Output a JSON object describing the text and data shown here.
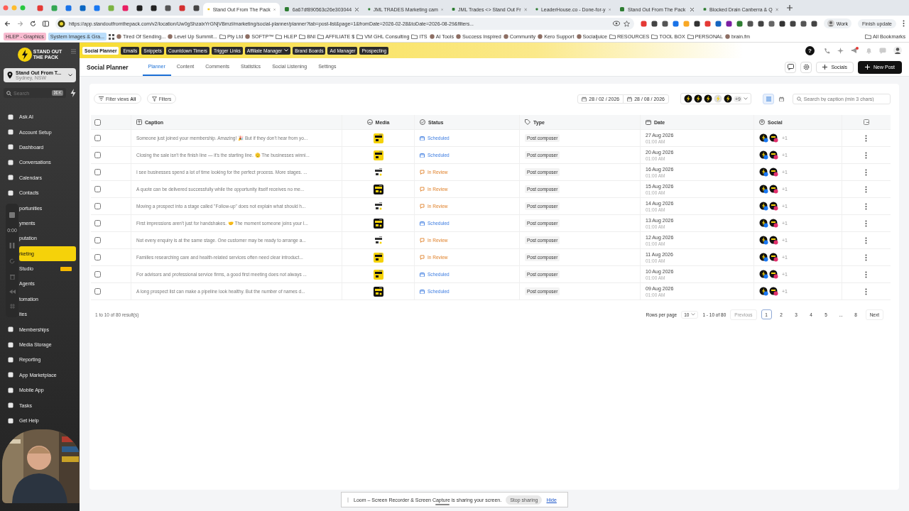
{
  "browser": {
    "pinned_tabs": [
      {
        "color": "#e53935"
      },
      {
        "color": "#34a853"
      },
      {
        "color": "#1a73e8"
      },
      {
        "color": "#0a66c2"
      },
      {
        "color": "#1877f2"
      },
      {
        "color": "#7cb342"
      },
      {
        "color": "#e91e63"
      },
      {
        "color": "#222222"
      },
      {
        "color": "#222222"
      },
      {
        "color": "#555555"
      },
      {
        "color": "#d32f2f"
      },
      {
        "color": "#444444"
      }
    ],
    "tabs": [
      {
        "title": "Stand Out From The Pack",
        "selected": true
      },
      {
        "title": "6a67df890563c26e303044",
        "selected": false
      },
      {
        "title": "JML TRADES Marketing cam",
        "selected": false
      },
      {
        "title": "JML Trades <> Stand Out Fr",
        "selected": false
      },
      {
        "title": "LeaderHouse.co - Done-for-y",
        "selected": false
      },
      {
        "title": "Stand Out From The Pack",
        "selected": false
      },
      {
        "title": "Blocked Drain Canberra & Q",
        "selected": false
      }
    ],
    "url": "https://app.standoutfromthepack.com/v2/location/Uw0gShzaixYrGNjVBmzl/marketing/social-planner/planner?tab=post-list&page=1&fromDate=2026-02-28&toDate=2026-08-29&filters...",
    "profile": "Work",
    "update_button": "Finish update",
    "bookmarks": [
      {
        "label": "HLEP - Graphics",
        "kind": "tag",
        "color": "#f8bbd0"
      },
      {
        "label": "System Images & Gra...",
        "kind": "tag",
        "color": "#bbdefb"
      },
      {
        "label": "Tired Of Sending...",
        "kind": "link"
      },
      {
        "label": "Level Up Summit...",
        "kind": "link"
      },
      {
        "label": "Pty Ltd",
        "kind": "folder"
      },
      {
        "label": "SOFTP™",
        "kind": "link"
      },
      {
        "label": "HLEP",
        "kind": "folder"
      },
      {
        "label": "BNI",
        "kind": "folder"
      },
      {
        "label": "AFFILIATE $",
        "kind": "folder"
      },
      {
        "label": "VM GHL Consulting",
        "kind": "folder"
      },
      {
        "label": "ITS",
        "kind": "folder"
      },
      {
        "label": "AI Tools",
        "kind": "link"
      },
      {
        "label": "Success Inspired",
        "kind": "link"
      },
      {
        "label": "Community",
        "kind": "link"
      },
      {
        "label": "Kero Support",
        "kind": "link"
      },
      {
        "label": "Socialjuice",
        "kind": "link"
      },
      {
        "label": "RESOURCES",
        "kind": "folder"
      },
      {
        "label": "TOOL BOX",
        "kind": "folder"
      },
      {
        "label": "PERSONAL",
        "kind": "folder"
      },
      {
        "label": "brain.fm",
        "kind": "link"
      }
    ],
    "all_bookmarks": "All Bookmarks"
  },
  "sidebar": {
    "logo": [
      "STAND OUT",
      "THE PACK"
    ],
    "location": {
      "name": "Stand Out From T...",
      "place": "Sydney, NSW"
    },
    "search": {
      "placeholder": "Search",
      "shortcut": "⌘K"
    },
    "items": [
      {
        "label": "Ask AI",
        "selected": false,
        "covered": false
      },
      {
        "label": "Account Setup",
        "selected": false,
        "covered": false
      },
      {
        "label": "Dashboard",
        "selected": false,
        "covered": false
      },
      {
        "label": "Conversations",
        "selected": false,
        "covered": false
      },
      {
        "label": "Calendars",
        "selected": false,
        "covered": false
      },
      {
        "label": "Contacts",
        "selected": false,
        "covered": false
      },
      {
        "label": "portunities",
        "selected": false,
        "covered": true
      },
      {
        "label": "yments",
        "selected": false,
        "covered": true
      },
      {
        "label": "putation",
        "selected": false,
        "covered": true
      },
      {
        "label": "rketing",
        "selected": true,
        "covered": true
      },
      {
        "label": "Studio",
        "selected": false,
        "covered": true,
        "badge": true
      },
      {
        "label": "Agents",
        "selected": false,
        "covered": true
      },
      {
        "label": "tomation",
        "selected": false,
        "covered": true
      },
      {
        "label": "ites",
        "selected": false,
        "covered": true
      },
      {
        "label": "Memberships",
        "selected": false,
        "covered": false
      },
      {
        "label": "Media Storage",
        "selected": false,
        "covered": false
      },
      {
        "label": "Reporting",
        "selected": false,
        "covered": false
      },
      {
        "label": "App Marketplace",
        "selected": false,
        "covered": false
      },
      {
        "label": "Mobile App",
        "selected": false,
        "covered": false
      },
      {
        "label": "Tasks",
        "selected": false,
        "covered": false
      },
      {
        "label": "Get Help",
        "selected": false,
        "covered": false
      }
    ],
    "recorder": {
      "time": "0:00"
    }
  },
  "topbar": {
    "items": [
      {
        "label": "Social Planner",
        "selected": true
      },
      {
        "label": "Emails",
        "selected": false
      },
      {
        "label": "Snippets",
        "selected": false
      },
      {
        "label": "Countdown Timers",
        "selected": false
      },
      {
        "label": "Trigger Links",
        "selected": false
      },
      {
        "label": "Affiliate Manager",
        "selected": false,
        "dropdown": true
      },
      {
        "label": "Brand Boards",
        "selected": false
      },
      {
        "label": "Ad Manager",
        "selected": false
      },
      {
        "label": "Prospecting",
        "selected": false
      }
    ],
    "help": "?"
  },
  "header": {
    "title": "Social Planner",
    "tabs": [
      {
        "label": "Planner",
        "selected": true
      },
      {
        "label": "Content",
        "selected": false
      },
      {
        "label": "Comments",
        "selected": false
      },
      {
        "label": "Statistics",
        "selected": false
      },
      {
        "label": "Social Listening",
        "selected": false
      },
      {
        "label": "Settings",
        "selected": false
      }
    ],
    "socials_button": "Socials",
    "new_post_button": "New Post"
  },
  "filters": {
    "filter_views": "Filter views **All**",
    "filters_button": "Filters",
    "date_from": "28 / 02 / 2026",
    "date_to": "28 / 08 / 2026",
    "more_accounts": "+9",
    "views": [
      {
        "kind": "list",
        "selected": true
      },
      {
        "kind": "calendar",
        "selected": false
      }
    ],
    "search": {
      "placeholder": "Search by caption (min 3 chars)"
    }
  },
  "table": {
    "all_checked": false,
    "columns": [
      "Caption",
      "Media",
      "Status",
      "Type",
      "Date",
      "Social"
    ],
    "rows": [
      {
        "checked": false,
        "caption": "Someone just joined your membership. Amazing! 🎉 But if they don't hear from yo...",
        "status": {
          "label": "Scheduled",
          "kind": "scheduled"
        },
        "type": "Post composer",
        "date": "27 Aug 2026",
        "time": "01:00 AM",
        "social_more": "+1"
      },
      {
        "checked": false,
        "caption": "Closing the sale isn't the finish line — it's the starting line. 🫡 The businesses winni...",
        "status": {
          "label": "Scheduled",
          "kind": "scheduled"
        },
        "type": "Post composer",
        "date": "20 Aug 2026",
        "time": "01:00 AM",
        "social_more": "+1"
      },
      {
        "checked": false,
        "caption": "I see businesses spend a lot of time looking for the perfect process. More stages. ...",
        "status": {
          "label": "In Review",
          "kind": "review"
        },
        "type": "Post composer",
        "date": "16 Aug 2026",
        "time": "01:00 AM",
        "social_more": "+1"
      },
      {
        "checked": false,
        "caption": "A quote can be delivered successfully while the opportunity itself receives no me...",
        "status": {
          "label": "In Review",
          "kind": "review"
        },
        "type": "Post composer",
        "date": "15 Aug 2026",
        "time": "01:00 AM",
        "social_more": "+1"
      },
      {
        "checked": false,
        "caption": "Moving a prospect into a stage called \"Follow-up\" does not explain what should h...",
        "status": {
          "label": "In Review",
          "kind": "review"
        },
        "type": "Post composer",
        "date": "14 Aug 2026",
        "time": "01:00 AM",
        "social_more": "+1"
      },
      {
        "checked": false,
        "caption": "First impressions aren't just for handshakes. 🤝 The moment someone joins your l...",
        "status": {
          "label": "Scheduled",
          "kind": "scheduled"
        },
        "type": "Post composer",
        "date": "13 Aug 2026",
        "time": "01:00 AM",
        "social_more": "+1"
      },
      {
        "checked": false,
        "caption": "Not every enquiry is at the same stage. One customer may be ready to arrange a...",
        "status": {
          "label": "In Review",
          "kind": "review"
        },
        "type": "Post composer",
        "date": "12 Aug 2026",
        "time": "01:00 AM",
        "social_more": "+1"
      },
      {
        "checked": false,
        "caption": "Families researching care and health-related services often need clear introduct...",
        "status": {
          "label": "In Review",
          "kind": "review"
        },
        "type": "Post composer",
        "date": "11 Aug 2026",
        "time": "01:00 AM",
        "social_more": "+1"
      },
      {
        "checked": false,
        "caption": "For advisors and professional service firms, a good first meeting does not always ...",
        "status": {
          "label": "Scheduled",
          "kind": "scheduled"
        },
        "type": "Post composer",
        "date": "10 Aug 2026",
        "time": "01:00 AM",
        "social_more": "+1"
      },
      {
        "checked": false,
        "caption": "A long prospect list can make a pipeline look healthy. But the number of names d...",
        "status": {
          "label": "Scheduled",
          "kind": "scheduled"
        },
        "type": "Post composer",
        "date": "09 Aug 2026",
        "time": "01:00 AM",
        "social_more": "+1"
      }
    ]
  },
  "footer": {
    "results": "1 to 10 of 80 result(s)",
    "rows_per_page_label": "Rows per page",
    "rows_per_page": "10",
    "range": "1 - 10 of 80",
    "previous": {
      "label": "Previous",
      "disabled": true
    },
    "pages": [
      {
        "label": "1",
        "selected": true
      },
      {
        "label": "2",
        "selected": false
      },
      {
        "label": "3",
        "selected": false
      },
      {
        "label": "4",
        "selected": false
      },
      {
        "label": "5",
        "selected": false
      },
      {
        "label": "...",
        "selected": false
      },
      {
        "label": "8",
        "selected": false
      }
    ],
    "next": {
      "label": "Next",
      "disabled": false
    }
  },
  "share_bar": {
    "message": "Loom – Screen Recorder & Screen Capture is sharing your screen.",
    "stop_button": "Stop sharing",
    "hide_link": "Hide"
  }
}
